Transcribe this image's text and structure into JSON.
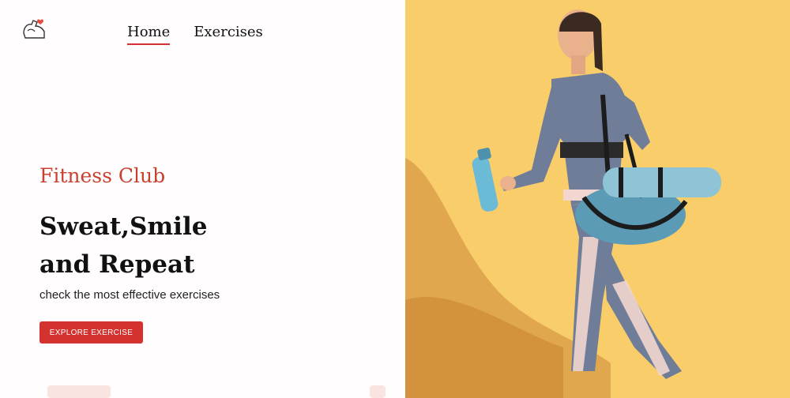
{
  "brand": {
    "logo_icon": "flexed-arm-heart-icon",
    "accent": "#d3322f"
  },
  "nav": {
    "items": [
      {
        "label": "Home",
        "active": true
      },
      {
        "label": "Exercises",
        "active": false
      }
    ]
  },
  "hero": {
    "tagline": "Fitness Club",
    "headline_line1": "Sweat,Smile",
    "headline_line2": "and Repeat",
    "subtitle": "check the most effective exercises",
    "cta_label": "EXPLORE EXERCISE",
    "background_color": "#f8cd6a"
  }
}
